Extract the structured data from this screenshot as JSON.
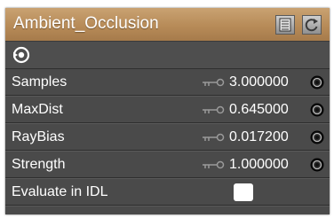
{
  "node": {
    "title": "Ambient_Occlusion",
    "header_icons": [
      "document-icon",
      "refresh-icon"
    ],
    "output_icon": "target-icon"
  },
  "params": [
    {
      "label": "Samples",
      "value": "3.000000"
    },
    {
      "label": "MaxDist",
      "value": "0.645000"
    },
    {
      "label": "RayBias",
      "value": "0.017200"
    },
    {
      "label": "Strength",
      "value": "1.000000"
    }
  ],
  "evaluate": {
    "label": "Evaluate in IDL",
    "checked": false
  },
  "colors": {
    "header": "#b78b58",
    "row_bg": "#4a4a4a",
    "text": "#ffffff"
  }
}
